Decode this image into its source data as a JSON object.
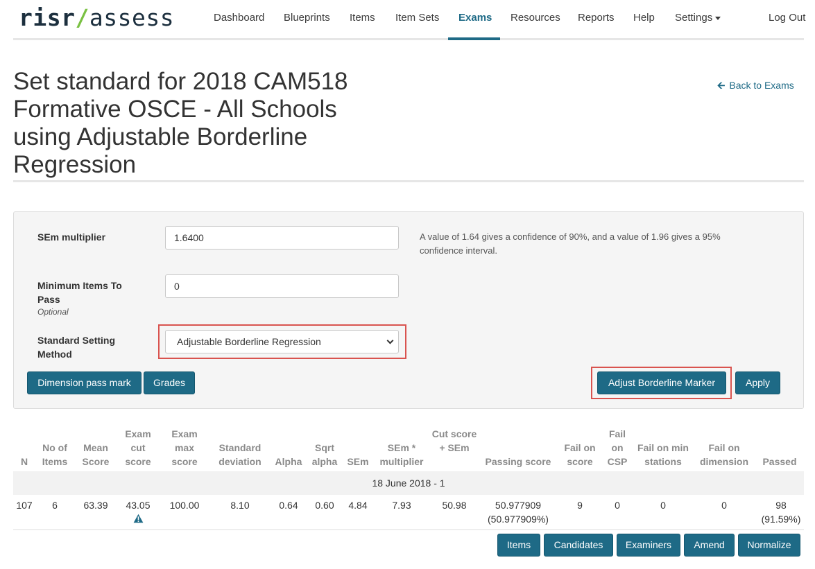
{
  "brand": {
    "part1": "risr",
    "slash": "/",
    "part2": "assess"
  },
  "nav": {
    "items": [
      "Dashboard",
      "Blueprints",
      "Items",
      "Item Sets",
      "Exams",
      "Resources",
      "Reports",
      "Help",
      "Settings",
      "Log Out"
    ],
    "active": "Exams"
  },
  "page": {
    "title": "Set standard for 2018 CAM518 Formative OSCE - All Schools using Adjustable Borderline Regression",
    "back_label": "Back to Exams"
  },
  "form": {
    "sem_label": "SEm multiplier",
    "sem_value": "1.6400",
    "sem_help": "A value of 1.64 gives a confidence of 90%, and a value of 1.96 gives a 95% confidence interval.",
    "min_items_label": "Minimum Items To Pass",
    "min_items_optional": "Optional",
    "min_items_value": "0",
    "method_label": "Standard Setting Method",
    "method_value": "Adjustable Borderline Regression",
    "buttons": {
      "dimension": "Dimension pass mark",
      "grades": "Grades",
      "adjust": "Adjust Borderline Marker",
      "apply": "Apply"
    }
  },
  "table": {
    "headers": [
      "N",
      "No of Items",
      "Mean Score",
      "Exam cut score",
      "Exam max score",
      "Standard deviation",
      "Alpha",
      "Sqrt alpha",
      "SEm",
      "SEm * multiplier",
      "Cut score + SEm",
      "Passing score",
      "Fail on score",
      "Fail on CSP",
      "Fail on min stations",
      "Fail on dimension",
      "Passed"
    ],
    "group_label": "18 June 2018 - 1",
    "row": [
      "107",
      "6",
      "63.39",
      "43.05",
      "100.00",
      "8.10",
      "0.64",
      "0.60",
      "4.84",
      "7.93",
      "50.98",
      "50.977909 (50.977909%)",
      "9",
      "0",
      "0",
      "0",
      "98 (91.59%)"
    ],
    "warning_icon": "warning-triangle-icon"
  },
  "row_actions": [
    "Items",
    "Candidates",
    "Examiners",
    "Amend",
    "Normalize"
  ],
  "colors": {
    "primary": "#1e6a86",
    "highlight": "#d9534f",
    "brand_green": "#7ac143"
  }
}
